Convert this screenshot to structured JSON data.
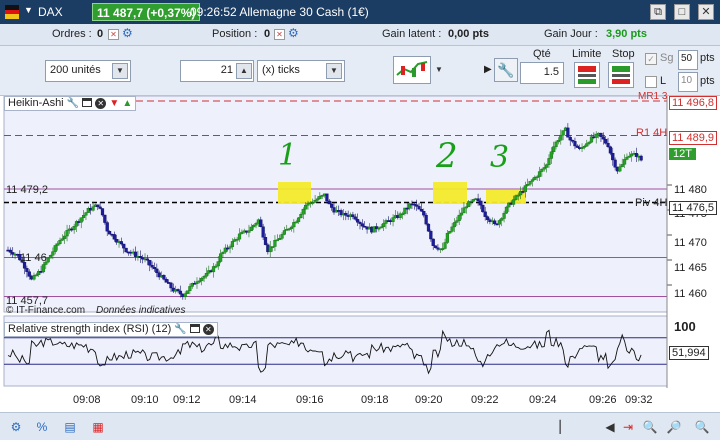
{
  "titlebar": {
    "instrument": "DAX",
    "price_change": "11 487,7 (+0,37%)",
    "time_name": "09:26:52 Allemagne 30 Cash (1€)",
    "colors": {
      "bg": "#1c3d63",
      "price_bg": "#2f9e2f"
    }
  },
  "orders_bar": {
    "orders_label": "Ordres :",
    "orders_value": "0",
    "position_label": "Position :",
    "position_value": "0",
    "latent_label": "Gain latent :",
    "latent_value": "0,00 pts",
    "day_label": "Gain Jour :",
    "day_value": "3,90 pts",
    "day_color": "#1a9a1a"
  },
  "trade_bar": {
    "units_value": "200 unités",
    "ticks_value": "21",
    "ticks_unit": "(x) ticks",
    "qty_label": "Qté",
    "qty_value": "1.5",
    "limit_label": "Limite",
    "stop_label": "Stop",
    "sg_label": "Sg",
    "sg_value": "50",
    "l_label": "L",
    "l_value": "10",
    "pts_label_1": "pts",
    "pts_label_2": "pts"
  },
  "price_panel": {
    "indicator_label": "Heikin-Ashi",
    "left_labels": {
      "top": "11 479,2",
      "mid": "11 46",
      "bottom": "11 457,7"
    },
    "copyright": "© IT-Finance.com",
    "indicative": "Données indicatives",
    "level_labels": {
      "r1_4h": "R1 4H",
      "piv_4h": "Piv 4H",
      "mr": "MR1 3"
    },
    "axis_ticks": [
      "11 480",
      "11 475",
      "11 470",
      "11 465",
      "11 460"
    ],
    "level_values": {
      "mr": "11 496,8",
      "r1": "11 489,9",
      "current": "12T",
      "piv": "11 476,5"
    },
    "annotations": [
      "1",
      "2",
      "3"
    ]
  },
  "rsi_panel": {
    "label": "Relative strength index (RSI) (12)",
    "top_value": "100",
    "current_value": "51,994"
  },
  "time_axis": [
    "09:08",
    "09:10",
    "09:12",
    "09:14",
    "09:16",
    "09:18",
    "09:20",
    "09:22",
    "09:24",
    "09:26",
    "09:32"
  ],
  "chart_data": {
    "type": "candlestick",
    "style": "heikin-ashi",
    "ylim": [
      11455,
      11497
    ],
    "x_ticks": [
      "09:08",
      "09:10",
      "09:12",
      "09:14",
      "09:16",
      "09:18",
      "09:20",
      "09:22",
      "09:24",
      "09:26",
      "09:32"
    ],
    "y_ticks": [
      11460,
      11465,
      11470,
      11475,
      11480
    ],
    "levels": [
      {
        "name": "MR1 3",
        "value": 11496.8,
        "color": "#d03030",
        "style": "dashed"
      },
      {
        "name": "R1 4H",
        "value": 11489.9,
        "color": "#d03030",
        "style": "dashed"
      },
      {
        "name": "11 479,2",
        "value": 11479.2,
        "color": "#a050a0",
        "style": "solid"
      },
      {
        "name": "Piv 4H",
        "value": 11476.5,
        "color": "#000000",
        "style": "dashed"
      },
      {
        "name": "11 46",
        "value": 11465.5,
        "color": "#a050a0",
        "style": "solid"
      },
      {
        "name": "11 457,7",
        "value": 11457.7,
        "color": "#a050a0",
        "style": "solid"
      }
    ],
    "price_path": [
      [
        0,
        11467
      ],
      [
        2,
        11466
      ],
      [
        4,
        11463
      ],
      [
        5,
        11461
      ],
      [
        7,
        11463
      ],
      [
        9,
        11466
      ],
      [
        11,
        11469
      ],
      [
        13,
        11471
      ],
      [
        15,
        11473
      ],
      [
        17,
        11475
      ],
      [
        19,
        11476
      ],
      [
        20,
        11474
      ],
      [
        21,
        11471
      ],
      [
        23,
        11469
      ],
      [
        25,
        11467
      ],
      [
        27,
        11466
      ],
      [
        29,
        11465
      ],
      [
        31,
        11463
      ],
      [
        33,
        11461
      ],
      [
        35,
        11459
      ],
      [
        37,
        11458
      ],
      [
        38,
        11459
      ],
      [
        40,
        11461
      ],
      [
        42,
        11462
      ],
      [
        44,
        11464
      ],
      [
        45,
        11466
      ],
      [
        47,
        11468
      ],
      [
        49,
        11470
      ],
      [
        51,
        11471
      ],
      [
        53,
        11473
      ],
      [
        54,
        11470
      ],
      [
        55,
        11467
      ],
      [
        57,
        11469
      ],
      [
        59,
        11471
      ],
      [
        61,
        11473
      ],
      [
        63,
        11476
      ],
      [
        65,
        11477
      ],
      [
        67,
        11478
      ],
      [
        68,
        11476
      ],
      [
        69,
        11475
      ],
      [
        71,
        11474
      ],
      [
        73,
        11474
      ],
      [
        75,
        11472
      ],
      [
        77,
        11471
      ],
      [
        79,
        11472
      ],
      [
        81,
        11473
      ],
      [
        83,
        11474
      ],
      [
        85,
        11476
      ],
      [
        86,
        11476
      ],
      [
        88,
        11474
      ],
      [
        89,
        11471
      ],
      [
        90,
        11468
      ],
      [
        92,
        11467
      ],
      [
        93,
        11470
      ],
      [
        95,
        11473
      ],
      [
        97,
        11476
      ],
      [
        99,
        11477
      ],
      [
        100,
        11476
      ],
      [
        101,
        11474
      ],
      [
        103,
        11472
      ],
      [
        104,
        11473
      ],
      [
        106,
        11476
      ],
      [
        108,
        11478
      ],
      [
        110,
        11480
      ],
      [
        112,
        11482
      ],
      [
        114,
        11484
      ],
      [
        115,
        11487
      ],
      [
        117,
        11490
      ],
      [
        118,
        11491
      ],
      [
        119,
        11489
      ],
      [
        121,
        11487
      ],
      [
        123,
        11489
      ],
      [
        125,
        11490
      ],
      [
        127,
        11488
      ],
      [
        128,
        11485
      ],
      [
        129,
        11483
      ],
      [
        130,
        11484
      ],
      [
        131,
        11486
      ],
      [
        133,
        11486
      ],
      [
        134,
        11485
      ]
    ],
    "rsi": {
      "ylim": [
        0,
        100
      ],
      "levels": [
        70,
        30
      ],
      "last": 51.994
    }
  }
}
